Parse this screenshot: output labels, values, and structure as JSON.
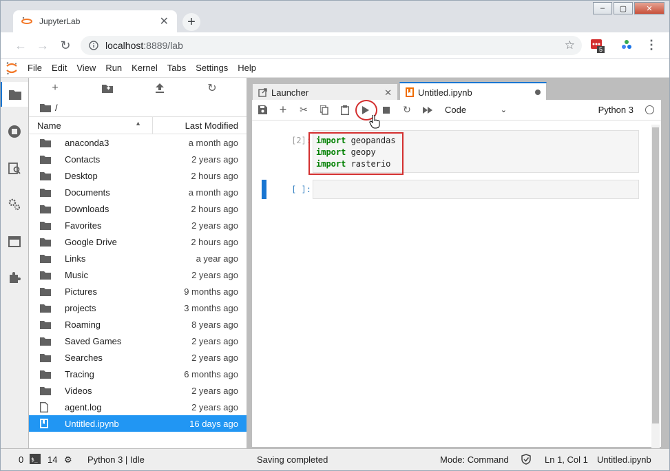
{
  "browser": {
    "tab_title": "JupyterLab",
    "tab_close": "✕",
    "new_tab": "+",
    "url_host": "localhost",
    "url_path": ":8889/lab",
    "extension_badge": "5"
  },
  "window_controls": {
    "minimize": "–",
    "maximize": "▢",
    "close": "✕"
  },
  "menu": [
    "File",
    "Edit",
    "View",
    "Run",
    "Kernel",
    "Tabs",
    "Settings",
    "Help"
  ],
  "filebrowser": {
    "breadcrumb": "/",
    "col_name": "Name",
    "col_modified": "Last Modified",
    "items": [
      {
        "name": "anaconda3",
        "modified": "a month ago",
        "type": "folder"
      },
      {
        "name": "Contacts",
        "modified": "2 years ago",
        "type": "folder"
      },
      {
        "name": "Desktop",
        "modified": "2 hours ago",
        "type": "folder"
      },
      {
        "name": "Documents",
        "modified": "a month ago",
        "type": "folder"
      },
      {
        "name": "Downloads",
        "modified": "2 hours ago",
        "type": "folder"
      },
      {
        "name": "Favorites",
        "modified": "2 years ago",
        "type": "folder"
      },
      {
        "name": "Google Drive",
        "modified": "2 hours ago",
        "type": "folder"
      },
      {
        "name": "Links",
        "modified": "a year ago",
        "type": "folder"
      },
      {
        "name": "Music",
        "modified": "2 years ago",
        "type": "folder"
      },
      {
        "name": "Pictures",
        "modified": "9 months ago",
        "type": "folder"
      },
      {
        "name": "projects",
        "modified": "3 months ago",
        "type": "folder"
      },
      {
        "name": "Roaming",
        "modified": "8 years ago",
        "type": "folder"
      },
      {
        "name": "Saved Games",
        "modified": "2 years ago",
        "type": "folder"
      },
      {
        "name": "Searches",
        "modified": "2 years ago",
        "type": "folder"
      },
      {
        "name": "Tracing",
        "modified": "6 months ago",
        "type": "folder"
      },
      {
        "name": "Videos",
        "modified": "2 years ago",
        "type": "folder"
      },
      {
        "name": "agent.log",
        "modified": "2 years ago",
        "type": "file"
      },
      {
        "name": "Untitled.ipynb",
        "modified": "16 days ago",
        "type": "notebook",
        "selected": true
      }
    ]
  },
  "dock": {
    "tabs": [
      {
        "label": "Launcher"
      },
      {
        "label": "Untitled.ipynb"
      }
    ]
  },
  "notebook": {
    "cell_type": "Code",
    "kernel": "Python 3",
    "cells": [
      {
        "prompt": "[2]:",
        "lines": [
          [
            "import",
            " geopandas"
          ],
          [
            "import",
            " geopy"
          ],
          [
            "import",
            " rasterio"
          ]
        ]
      },
      {
        "prompt": "[ ]:",
        "lines": []
      }
    ]
  },
  "status": {
    "terminals": "0",
    "kernels": "14",
    "kernel_state": "Python 3 | Idle",
    "message": "Saving completed",
    "mode": "Mode: Command",
    "position": "Ln 1, Col 1",
    "file": "Untitled.ipynb"
  },
  "colors": {
    "accent": "#1976d2",
    "selection": "#2196f3",
    "highlight": "#d32f2f",
    "keyword": "#008000"
  }
}
